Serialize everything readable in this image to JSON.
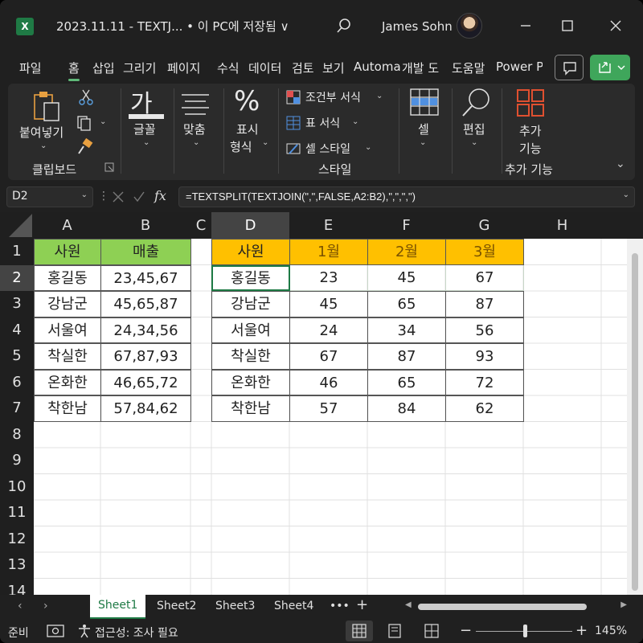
{
  "app": {
    "logo": "X",
    "doc_title": "2023.11.11 - TEXTJ...  • 이 PC에 저장됨 ∨",
    "user_name": "James Sohn"
  },
  "tabs": [
    "파일",
    "홈",
    "삽입",
    "그리기",
    "페이지",
    "수식",
    "데이터",
    "검토",
    "보기",
    "Automa",
    "개발 도",
    "도움말",
    "Power P"
  ],
  "ribbon": {
    "paste": "붙여넣기",
    "clipboard": "클립보드",
    "font": "글꼴",
    "align": "맞춤",
    "number_1": "표시",
    "number_2": "형식",
    "cond_format": "조건부 서식",
    "table_format": "표 서식",
    "cell_style": "셀 스타일",
    "style_group": "스타일",
    "cells": "셀",
    "editing": "편집",
    "addins_1": "추가",
    "addins_2": "기능",
    "addins_group": "추가 기능",
    "font_glyph": "가",
    "percent_glyph": "%"
  },
  "formula_bar": {
    "name_box": "D2",
    "fx": "fx",
    "formula": "=TEXTSPLIT(TEXTJOIN(\",\",FALSE,A2:B2),\",\",\",\")"
  },
  "columns": [
    "A",
    "B",
    "C",
    "D",
    "E",
    "F",
    "G",
    "H"
  ],
  "rows": [
    "1",
    "2",
    "3",
    "4",
    "5",
    "6",
    "7",
    "8",
    "9",
    "10",
    "11",
    "12",
    "13",
    "14"
  ],
  "source_table": {
    "headers": [
      "사원",
      "매출"
    ],
    "rows": [
      [
        "홍길동",
        "23,45,67"
      ],
      [
        "강남군",
        "45,65,87"
      ],
      [
        "서울여",
        "24,34,56"
      ],
      [
        "착실한",
        "67,87,93"
      ],
      [
        "온화한",
        "46,65,72"
      ],
      [
        "착한남",
        "57,84,62"
      ]
    ]
  },
  "result_table": {
    "headers": [
      "사원",
      "1월",
      "2월",
      "3월"
    ],
    "rows": [
      [
        "홍길동",
        "23",
        "45",
        "67"
      ],
      [
        "강남군",
        "45",
        "65",
        "87"
      ],
      [
        "서울여",
        "24",
        "34",
        "56"
      ],
      [
        "착실한",
        "67",
        "87",
        "93"
      ],
      [
        "온화한",
        "46",
        "65",
        "72"
      ],
      [
        "착한남",
        "57",
        "84",
        "62"
      ]
    ]
  },
  "sheets": [
    "Sheet1",
    "Sheet2",
    "Sheet3",
    "Sheet4"
  ],
  "sheet_more": "•••",
  "add_sheet": "+",
  "status": {
    "ready": "준비",
    "accessibility": "접근성: 조사 필요",
    "zoom": "145%"
  },
  "colors": {
    "header_green": "#8ed054",
    "header_orange": "#ffc000",
    "accent": "#1e7a45"
  }
}
